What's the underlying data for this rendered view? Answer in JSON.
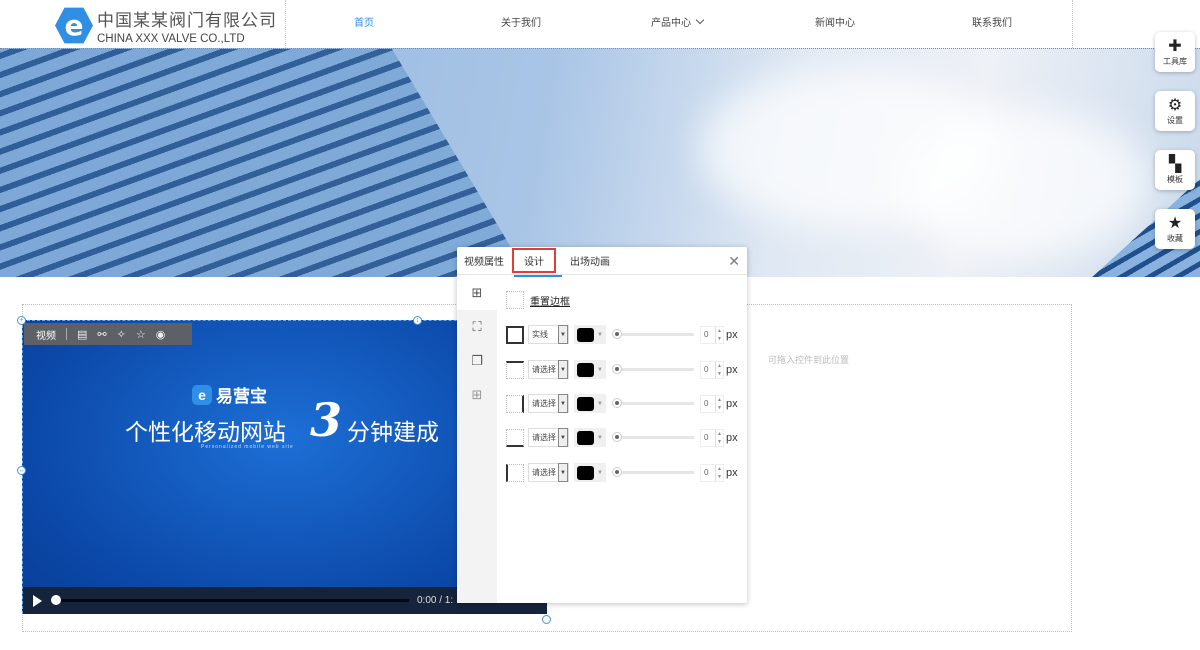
{
  "header": {
    "company_cn": "中国某某阀门有限公司",
    "company_en": "CHINA XXX VALVE CO.,LTD",
    "logo_letter": "e",
    "nav": [
      {
        "label": "首页",
        "active": true
      },
      {
        "label": "关于我们"
      },
      {
        "label": "产品中心"
      },
      {
        "label": "新闻中心"
      },
      {
        "label": "联系我们"
      }
    ]
  },
  "right_toolbar": [
    {
      "label": "工具库",
      "icon": "plus-icon"
    },
    {
      "label": "设置",
      "icon": "gears-icon"
    },
    {
      "label": "模板",
      "icon": "grid-icon"
    },
    {
      "label": "收藏",
      "icon": "star-icon"
    }
  ],
  "drop_hint": "可拖入控件到此位置",
  "video": {
    "toolbar_label": "视频",
    "promo_brand": "易营宝",
    "promo_main": "个性化移动网站",
    "promo_number": "3",
    "promo_end": "分钟建成",
    "promo_sub": "Personalized mobile web site",
    "time": "0:00 / 1:",
    "progress": 0
  },
  "panel": {
    "tabs": [
      "视频属性",
      "设计",
      "出场动画"
    ],
    "active_tab": "设计",
    "reset_label": "重置边框",
    "unit": "px",
    "rows": [
      {
        "style": "实线",
        "value": "0",
        "color": "#000000"
      },
      {
        "style": "请选择",
        "value": "0",
        "color": "#000000"
      },
      {
        "style": "请选择",
        "value": "0",
        "color": "#000000"
      },
      {
        "style": "请选择",
        "value": "0",
        "color": "#000000"
      },
      {
        "style": "请选择",
        "value": "0",
        "color": "#000000"
      }
    ]
  },
  "colors": {
    "accent": "#2f8fe6",
    "highlight": "#e23c3c"
  }
}
